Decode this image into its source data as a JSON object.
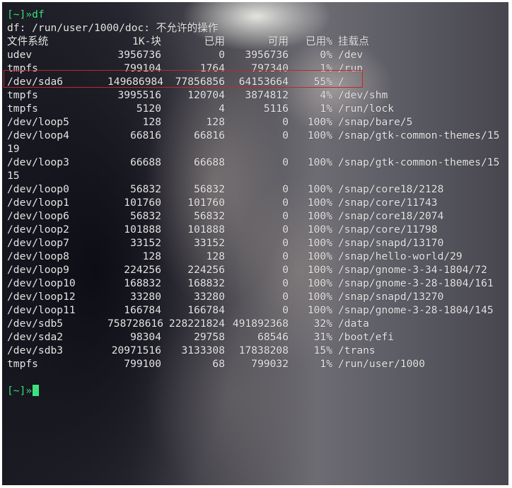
{
  "terminal": {
    "command_line": {
      "prompt": "[~]»",
      "command": "df"
    },
    "error_line": "df: /run/user/1000/doc: 不允许的操作",
    "header": {
      "filesystem": "文件系统",
      "blocks": "1K-块",
      "used": "已用",
      "available": "可用",
      "use_pct": "已用%",
      "mounted_on": "挂载点"
    },
    "rows": [
      {
        "fs": "udev",
        "blocks": "3956736",
        "used": "0",
        "avail": "3956736",
        "pct": "0%",
        "mount": "/dev"
      },
      {
        "fs": "tmpfs",
        "blocks": "799104",
        "used": "1764",
        "avail": "797340",
        "pct": "1%",
        "mount": "/run"
      },
      {
        "fs": "/dev/sda6",
        "blocks": "149686984",
        "used": "77856856",
        "avail": "64153664",
        "pct": "55%",
        "mount": "/"
      },
      {
        "fs": "tmpfs",
        "blocks": "3995516",
        "used": "120704",
        "avail": "3874812",
        "pct": "4%",
        "mount": "/dev/shm"
      },
      {
        "fs": "tmpfs",
        "blocks": "5120",
        "used": "4",
        "avail": "5116",
        "pct": "1%",
        "mount": "/run/lock"
      },
      {
        "fs": "/dev/loop5",
        "blocks": "128",
        "used": "128",
        "avail": "0",
        "pct": "100%",
        "mount": "/snap/bare/5"
      },
      {
        "fs": "/dev/loop4",
        "blocks": "66816",
        "used": "66816",
        "avail": "0",
        "pct": "100%",
        "mount": "/snap/gtk-common-themes/15",
        "wrap": "19"
      },
      {
        "fs": "/dev/loop3",
        "blocks": "66688",
        "used": "66688",
        "avail": "0",
        "pct": "100%",
        "mount": "/snap/gtk-common-themes/15",
        "wrap": "15"
      },
      {
        "fs": "/dev/loop0",
        "blocks": "56832",
        "used": "56832",
        "avail": "0",
        "pct": "100%",
        "mount": "/snap/core18/2128"
      },
      {
        "fs": "/dev/loop1",
        "blocks": "101760",
        "used": "101760",
        "avail": "0",
        "pct": "100%",
        "mount": "/snap/core/11743"
      },
      {
        "fs": "/dev/loop6",
        "blocks": "56832",
        "used": "56832",
        "avail": "0",
        "pct": "100%",
        "mount": "/snap/core18/2074"
      },
      {
        "fs": "/dev/loop2",
        "blocks": "101888",
        "used": "101888",
        "avail": "0",
        "pct": "100%",
        "mount": "/snap/core/11798"
      },
      {
        "fs": "/dev/loop7",
        "blocks": "33152",
        "used": "33152",
        "avail": "0",
        "pct": "100%",
        "mount": "/snap/snapd/13170"
      },
      {
        "fs": "/dev/loop8",
        "blocks": "128",
        "used": "128",
        "avail": "0",
        "pct": "100%",
        "mount": "/snap/hello-world/29"
      },
      {
        "fs": "/dev/loop9",
        "blocks": "224256",
        "used": "224256",
        "avail": "0",
        "pct": "100%",
        "mount": "/snap/gnome-3-34-1804/72"
      },
      {
        "fs": "/dev/loop10",
        "blocks": "168832",
        "used": "168832",
        "avail": "0",
        "pct": "100%",
        "mount": "/snap/gnome-3-28-1804/161"
      },
      {
        "fs": "/dev/loop12",
        "blocks": "33280",
        "used": "33280",
        "avail": "0",
        "pct": "100%",
        "mount": "/snap/snapd/13270"
      },
      {
        "fs": "/dev/loop11",
        "blocks": "166784",
        "used": "166784",
        "avail": "0",
        "pct": "100%",
        "mount": "/snap/gnome-3-28-1804/145"
      },
      {
        "fs": "/dev/sdb5",
        "blocks": "758728616",
        "used": "228221824",
        "avail": "491892368",
        "pct": "32%",
        "mount": "/data"
      },
      {
        "fs": "/dev/sda2",
        "blocks": "98304",
        "used": "29758",
        "avail": "68546",
        "pct": "31%",
        "mount": "/boot/efi"
      },
      {
        "fs": "/dev/sdb3",
        "blocks": "20971516",
        "used": "3133308",
        "avail": "17838208",
        "pct": "15%",
        "mount": "/trans"
      },
      {
        "fs": "tmpfs",
        "blocks": "799100",
        "used": "68",
        "avail": "799032",
        "pct": "1%",
        "mount": "/run/user/1000"
      }
    ],
    "final_prompt": "[~]»",
    "colors": {
      "prompt": "#3ee07d",
      "text": "#e6e6e6",
      "highlight_box": "#c02828"
    }
  }
}
